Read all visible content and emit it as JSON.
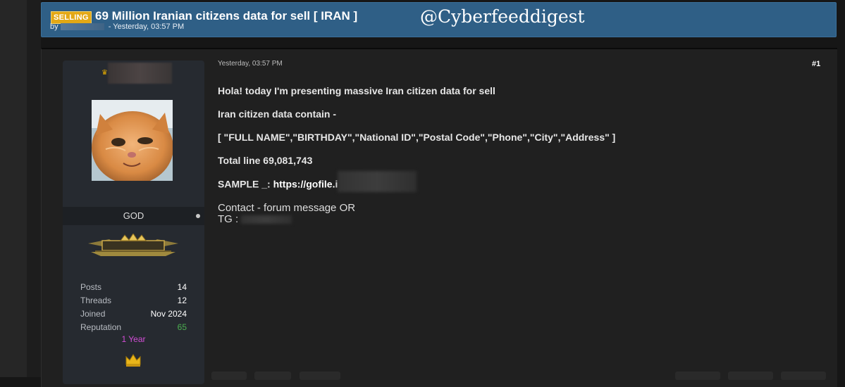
{
  "thread": {
    "prefix": "SELLING",
    "title": "69 Million Iranian citizens data for sell [ IRAN ]",
    "by": "by",
    "posted": "- Yesterday, 03:57 PM"
  },
  "watermark": "@Cyberfeeddigest",
  "post": {
    "date": "Yesterday, 03:57 PM",
    "number": "#1",
    "line1": "Hola! today I'm presenting massive Iran citizen data for sell",
    "line2": "Iran citizen data contain -",
    "line3": "[ \"FULL NAME\",\"BIRTHDAY\",\"National ID\",\"Postal Code\",\"Phone\",\"City\",\"Address\" ]",
    "line4": "Total line 69,081,743",
    "sample_label": "SAMPLE _:",
    "sample_link": "https://gofile.i",
    "contact": "Contact - forum message OR",
    "tg_label": "TG :"
  },
  "author": {
    "usergroup": "GOD",
    "tenure": "1 Year",
    "stats": [
      {
        "label": "Posts",
        "value": "14"
      },
      {
        "label": "Threads",
        "value": "12"
      },
      {
        "label": "Joined",
        "value": "Nov 2024"
      },
      {
        "label": "Reputation",
        "value": "65"
      }
    ]
  },
  "colors": {
    "header_bg": "#2f5f86",
    "prefix_badge": "#e3a815",
    "reputation": "#4caf50",
    "tenure": "#d24dd6"
  }
}
